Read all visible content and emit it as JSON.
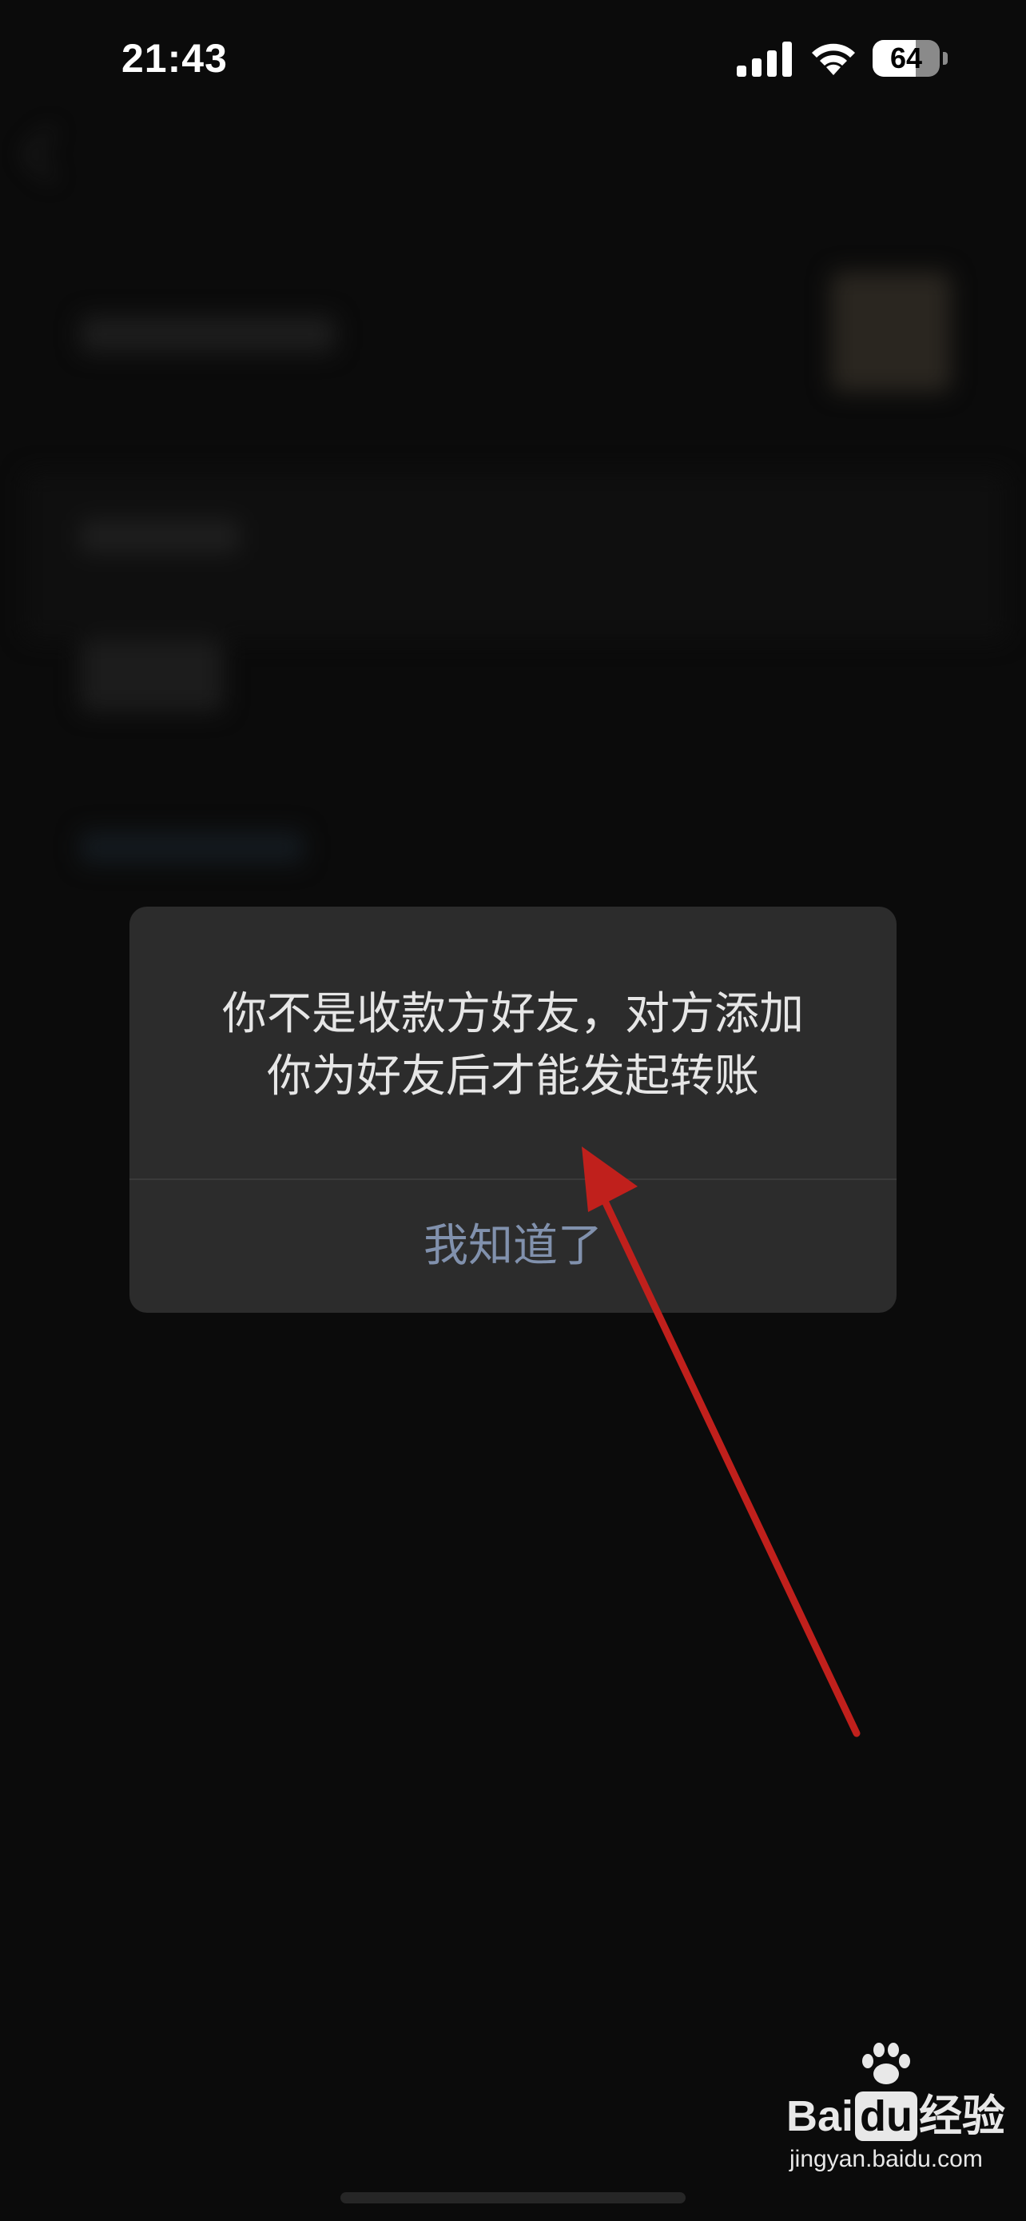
{
  "status_bar": {
    "time": "21:43",
    "battery_level": "64",
    "battery_fraction": 0.64,
    "signal_icon": "cellular-signal-icon",
    "wifi_icon": "wifi-icon"
  },
  "dialog": {
    "message_line1": "你不是收款方好友，对方添加",
    "message_line2": "你为好友后才能发起转账",
    "button_label": "我知道了"
  },
  "annotation": {
    "color": "#c0201c",
    "type": "red-arrow"
  },
  "watermark": {
    "logo_pre": "Bai",
    "logo_du": "du",
    "logo_post": "经验",
    "url": "jingyan.baidu.com"
  },
  "colors": {
    "background": "#0b0b0b",
    "dialog_bg": "#2c2c2c",
    "dialog_text": "#e6e6e6",
    "button_text": "#8191ad"
  }
}
